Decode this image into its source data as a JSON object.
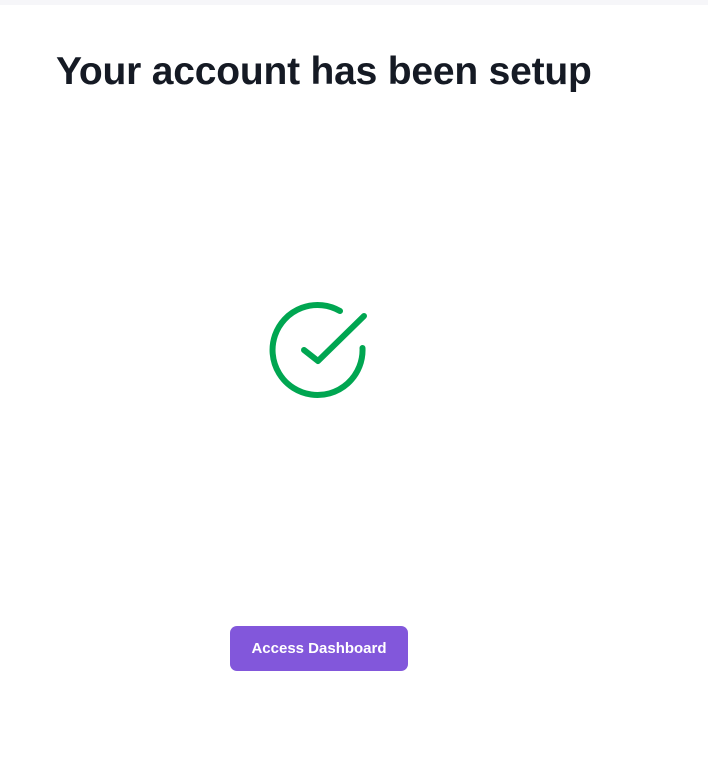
{
  "header": {
    "title": "Your account has been setup"
  },
  "status": {
    "icon": "check-circle-icon",
    "color": "#00a651"
  },
  "actions": {
    "primary_label": "Access Dashboard",
    "primary_color": "#8257db"
  }
}
